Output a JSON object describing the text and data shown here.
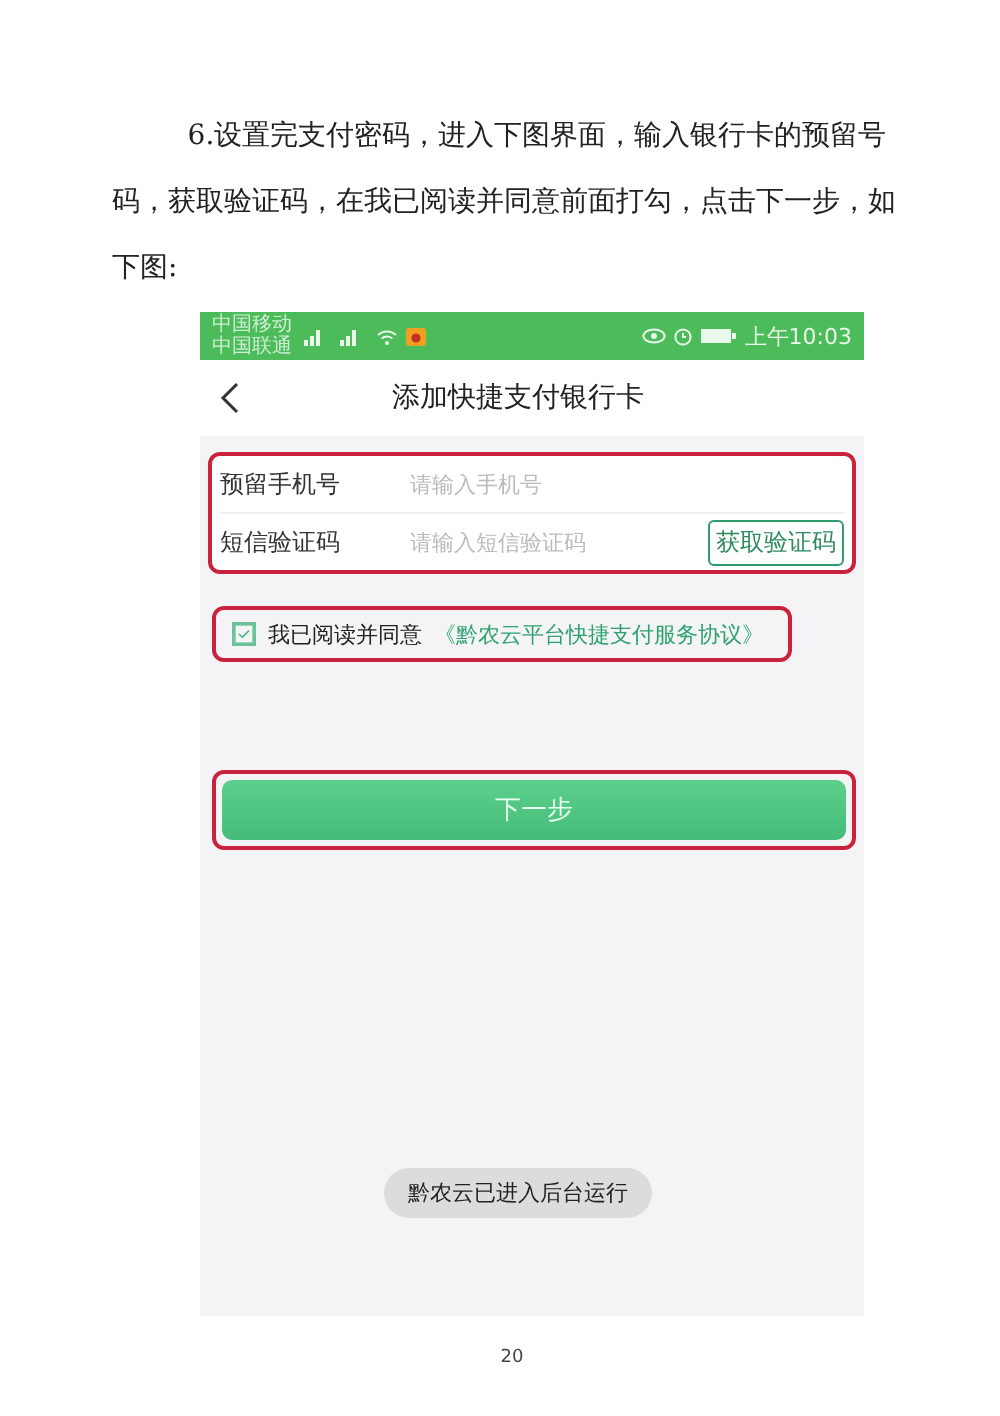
{
  "instruction": "6.设置完支付密码，进入下图界面，输入银行卡的预留号码，获取验证码，在我已阅读并同意前面打勾，点击下一步，如下图:",
  "phone": {
    "status_bar": {
      "carriers": [
        "中国移动",
        "中国联通"
      ],
      "time": "上午10:03"
    },
    "header": {
      "title": "添加快捷支付银行卡"
    },
    "fields": [
      {
        "label": "预留手机号",
        "placeholder": "请输入手机号"
      },
      {
        "label": "短信验证码",
        "placeholder": "请输入短信验证码",
        "action": "获取验证码"
      }
    ],
    "agreement": {
      "checked": true,
      "text": "我已阅读并同意",
      "link": "《黔农云平台快捷支付服务协议》"
    },
    "next_button": "下一步",
    "toast": "黔农云已进入后台运行"
  },
  "page_number": "20"
}
